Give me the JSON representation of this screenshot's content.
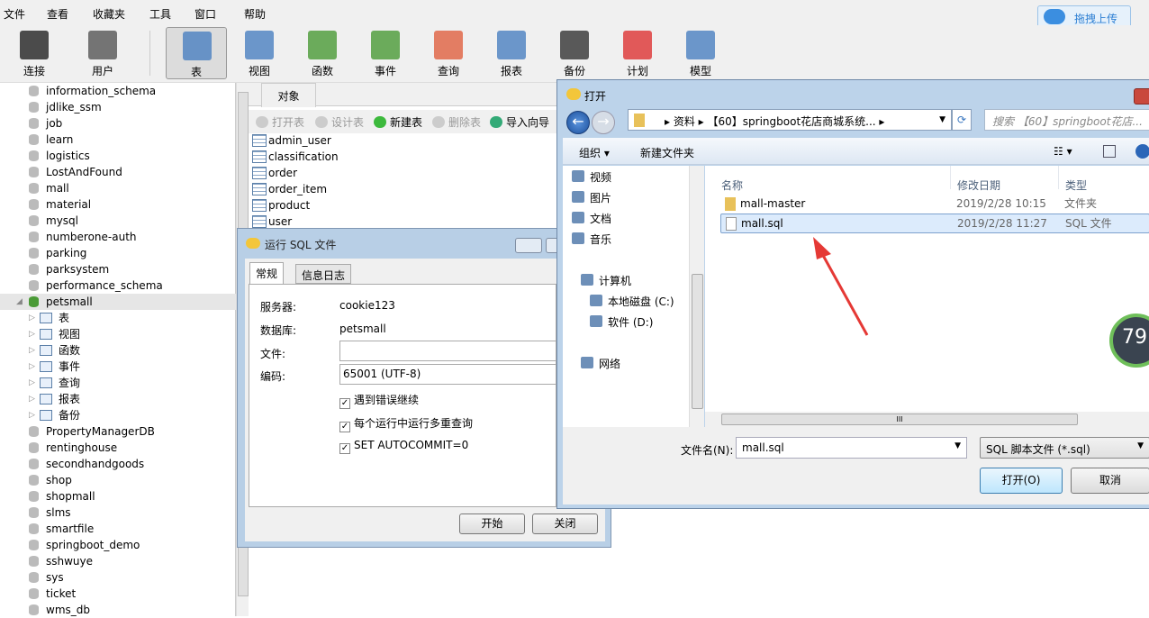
{
  "menu": [
    "文件",
    "查看",
    "收藏夹",
    "工具",
    "窗口",
    "帮助"
  ],
  "upload_label": "拖拽上传",
  "toolbar": [
    {
      "label": "连接",
      "icon": "plug-icon"
    },
    {
      "label": "用户",
      "icon": "user-icon"
    },
    {
      "label": "表",
      "icon": "table-icon",
      "selected": true
    },
    {
      "label": "视图",
      "icon": "view-icon"
    },
    {
      "label": "函数",
      "icon": "function-icon"
    },
    {
      "label": "事件",
      "icon": "event-icon"
    },
    {
      "label": "查询",
      "icon": "query-icon"
    },
    {
      "label": "报表",
      "icon": "report-icon"
    },
    {
      "label": "备份",
      "icon": "backup-icon"
    },
    {
      "label": "计划",
      "icon": "schedule-icon"
    },
    {
      "label": "模型",
      "icon": "model-icon"
    }
  ],
  "sidebar": {
    "before": [
      "information_schema",
      "jdlike_ssm",
      "job",
      "learn",
      "logistics",
      "LostAndFound",
      "mall",
      "material",
      "mysql",
      "numberone-auth",
      "parking",
      "parksystem",
      "performance_schema"
    ],
    "selected": "petsmall",
    "children": [
      "表",
      "视图",
      "函数",
      "事件",
      "查询",
      "报表",
      "备份"
    ],
    "after": [
      "PropertyManagerDB",
      "rentinghouse",
      "secondhandgoods",
      "shop",
      "shopmall",
      "slms",
      "smartfile",
      "springboot_demo",
      "sshwuye",
      "sys",
      "ticket",
      "wms_db"
    ]
  },
  "main": {
    "tab": "对象",
    "actions": [
      {
        "label": "打开表",
        "disabled": true
      },
      {
        "label": "设计表",
        "disabled": true
      },
      {
        "label": "新建表",
        "disabled": false
      },
      {
        "label": "删除表",
        "disabled": true
      },
      {
        "label": "导入向导",
        "disabled": false
      }
    ],
    "tables": [
      "admin_user",
      "classification",
      "order",
      "order_item",
      "product",
      "user"
    ]
  },
  "run_sql": {
    "title": "运行 SQL 文件",
    "tabs": [
      "常规",
      "信息日志"
    ],
    "server_label": "服务器:",
    "server": "cookie123",
    "db_label": "数据库:",
    "db": "petsmall",
    "file_label": "文件:",
    "file": "",
    "encoding_label": "编码:",
    "encoding": "65001 (UTF-8)",
    "options": [
      {
        "label": "遇到错误继续",
        "checked": true
      },
      {
        "label": "每个运行中运行多重查询",
        "checked": true
      },
      {
        "label": "SET AUTOCOMMIT=0",
        "checked": true
      }
    ],
    "start": "开始",
    "close": "关闭"
  },
  "open_dialog": {
    "title": "打开",
    "path": [
      "资料",
      "【60】springboot花店商城系统..."
    ],
    "search_placeholder": "搜索 【60】springboot花店...",
    "organize": "组织 ▾",
    "new_folder": "新建文件夹",
    "nav": [
      {
        "label": "视频",
        "icon": "video-icon"
      },
      {
        "label": "图片",
        "icon": "picture-icon"
      },
      {
        "label": "文档",
        "icon": "document-icon"
      },
      {
        "label": "音乐",
        "icon": "music-icon"
      },
      {
        "label": "计算机",
        "icon": "computer-icon"
      },
      {
        "label": "本地磁盘 (C:)",
        "icon": "drive-icon"
      },
      {
        "label": "软件 (D:)",
        "icon": "drive-icon"
      },
      {
        "label": "网络",
        "icon": "network-icon"
      }
    ],
    "columns": [
      "名称",
      "修改日期",
      "类型"
    ],
    "files": [
      {
        "name": "mall-master",
        "date": "2019/2/28 10:15",
        "type": "文件夹"
      },
      {
        "name": "mall.sql",
        "date": "2019/2/28 11:27",
        "type": "SQL 文件",
        "selected": true
      }
    ],
    "filename_label": "文件名(N):",
    "filename": "mall.sql",
    "filetype": "SQL 脚本文件 (*.sql)",
    "open": "打开(O)",
    "cancel": "取消"
  },
  "gauge": "79"
}
